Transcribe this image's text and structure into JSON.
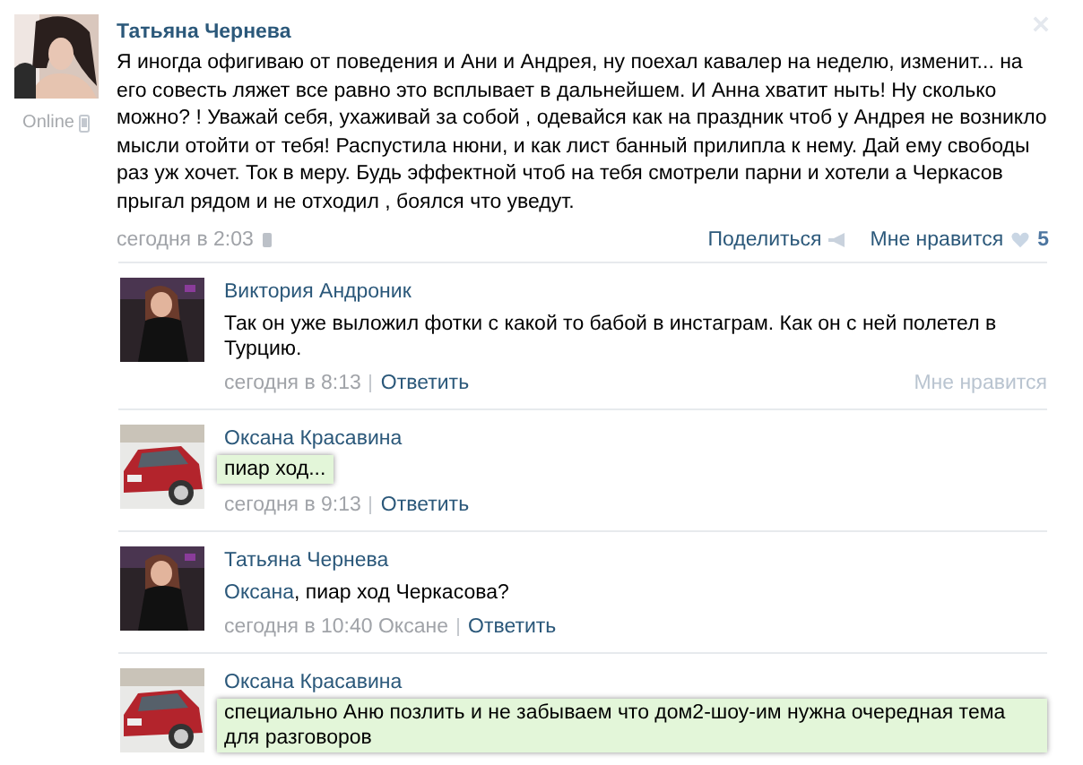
{
  "post": {
    "author": "Татьяна Чернева",
    "status": "Online",
    "mobile": true,
    "text": "Я иногда офигиваю от поведения и Ани и Андрея, ну поехал кавалер на неделю, изменит... на его совесть ляжет все равно это всплывает в дальнейшем. И Анна хватит ныть! Ну сколько можно? ! Уважай себя, ухаживай за собой , одевайся как на праздник чтоб у Андрея не возникло мысли отойти от тебя! Распустила нюни, и как лист банный прилипла к нему. Дай ему свободы раз уж хочет. Ток в меру. Будь эффектной чтоб на тебя смотрели парни и хотели а Черкасов прыгал рядом и не отходил , боялся что уведут.",
    "date": "сегодня в 2:03",
    "share": "Поделиться",
    "like": "Мне нравится",
    "like_count": "5",
    "liked": false
  },
  "replies": [
    {
      "author": "Виктория Андроник",
      "kind": "woman",
      "text": "Так он уже выложил фотки с какой то бабой в инстаграм. Как он с ней полетел в Турцию.",
      "highlighted": false,
      "date": "сегодня в 8:13",
      "reply": "Ответить",
      "like_hint": "Мне нравится"
    },
    {
      "author": "Оксана Красавина",
      "kind": "car",
      "text": "пиар ход...",
      "highlighted": true,
      "date": "сегодня в 9:13",
      "reply": "Ответить"
    },
    {
      "author": "Татьяна Чернева",
      "kind": "woman",
      "mention": "Оксана",
      "text": ", пиар ход Черкасова?",
      "highlighted": false,
      "date": "сегодня в 10:40",
      "reply_to": "Оксане",
      "reply": "Ответить"
    },
    {
      "author": "Оксана Красавина",
      "kind": "car",
      "text": "специально Аню позлить и не забываем что дом2-шоу-им нужна очередная тема для разговоров",
      "highlighted": true
    }
  ]
}
